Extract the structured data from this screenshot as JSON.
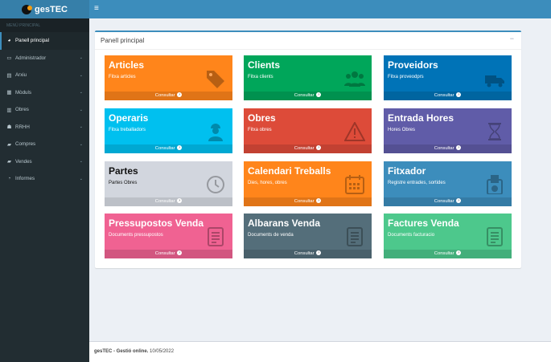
{
  "app": {
    "logo_text": "gesTEC"
  },
  "sidebar": {
    "header": "MENÚ PRINCIPAL",
    "items": [
      {
        "label": "Panell principal",
        "icon": "dashboard-icon",
        "glyph": "◕"
      },
      {
        "label": "Administrador",
        "icon": "laptop-icon",
        "glyph": "▭"
      },
      {
        "label": "Arxiu",
        "icon": "folder-icon",
        "glyph": "▤"
      },
      {
        "label": "Mòduls",
        "icon": "grid-icon",
        "glyph": "▦"
      },
      {
        "label": "Obres",
        "icon": "building-icon",
        "glyph": "▥"
      },
      {
        "label": "RRHH",
        "icon": "users-icon",
        "glyph": "☗"
      },
      {
        "label": "Compres",
        "icon": "book-icon",
        "glyph": "▰"
      },
      {
        "label": "Vendes",
        "icon": "book-icon",
        "glyph": "▰"
      },
      {
        "label": "Informes",
        "icon": "pie-chart-icon",
        "glyph": "◔"
      }
    ]
  },
  "main": {
    "box_title": "Panell principal",
    "collapse": "−",
    "consultar_label": "Consultar",
    "tiles": [
      {
        "title": "Articles",
        "subtitle": "Fitxa articles",
        "color": "#ff851b",
        "icon": "tags-icon"
      },
      {
        "title": "Clients",
        "subtitle": "Fitxa clients",
        "color": "#00a65a",
        "icon": "users-icon"
      },
      {
        "title": "Proveidors",
        "subtitle": "Fitxa proveodprs",
        "color": "#0073b7",
        "icon": "truck-icon"
      },
      {
        "title": "Operaris",
        "subtitle": "Fitxa treballadors",
        "color": "#00c0ef",
        "icon": "worker-icon"
      },
      {
        "title": "Obres",
        "subtitle": "Fitxa obres",
        "color": "#dd4b39",
        "icon": "warning-icon"
      },
      {
        "title": "Entrada Hores",
        "subtitle": "Hores Obres",
        "color": "#605ca8",
        "icon": "hourglass-icon"
      },
      {
        "title": "Partes",
        "subtitle": "Partes Obres",
        "color": "#d2d6de",
        "icon": "clock-icon"
      },
      {
        "title": "Calendari Treballs",
        "subtitle": "Dies, hores, obres",
        "color": "#ff851b",
        "icon": "calendar-icon"
      },
      {
        "title": "Fitxador",
        "subtitle": "Registre entrades, sortides",
        "color": "#3c8dbc",
        "icon": "card-reader-icon"
      },
      {
        "title": "Pressupostos Venda",
        "subtitle": "Documents pressupostos",
        "color": "#f06292",
        "icon": "document-icon"
      },
      {
        "title": "Albarans Venda",
        "subtitle": "Documents de venda",
        "color": "#546e7a",
        "icon": "document-icon"
      },
      {
        "title": "Factures Venda",
        "subtitle": "Documents facturacio",
        "color": "#4dc88c",
        "icon": "document-icon"
      }
    ]
  },
  "footer": {
    "brand": "gesTEC - Gestió online.",
    "date": "10/05/2022"
  }
}
